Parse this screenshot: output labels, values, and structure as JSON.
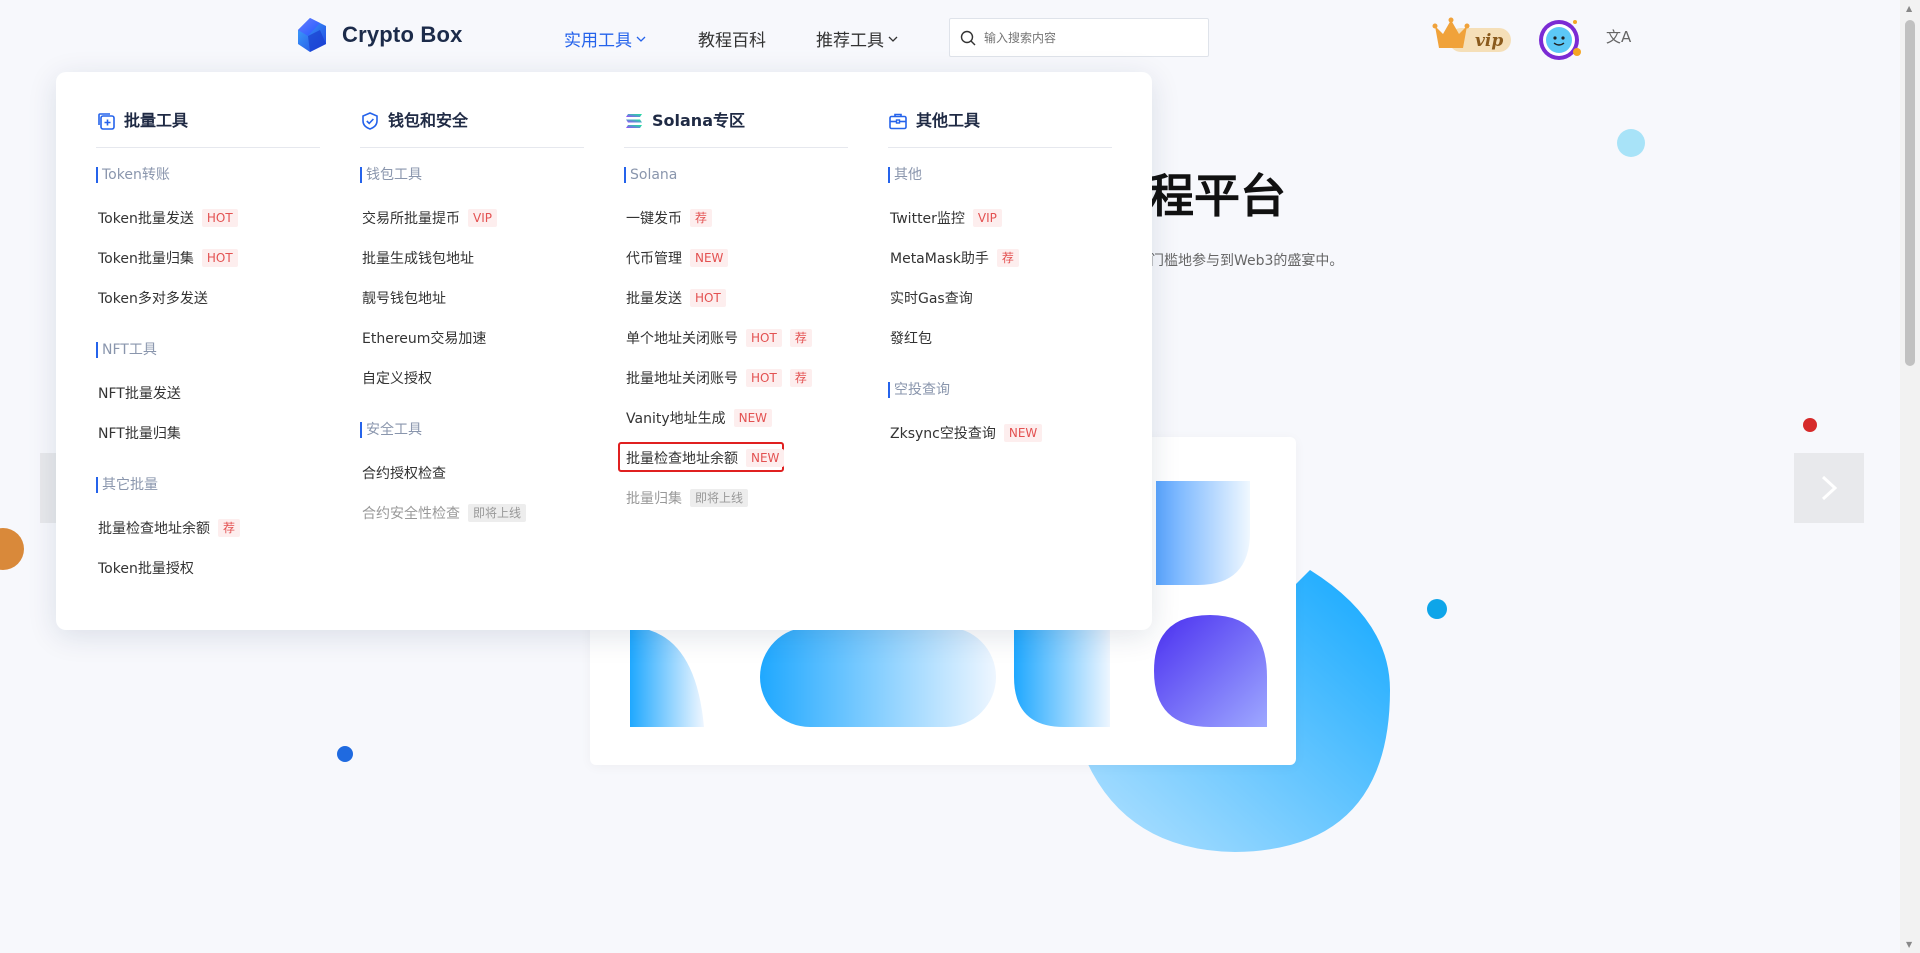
{
  "header": {
    "logo_text": "Crypto Box",
    "nav": [
      {
        "label": "实用工具",
        "active": true,
        "has_chevron": true
      },
      {
        "label": "教程百科",
        "active": false,
        "has_chevron": false
      },
      {
        "label": "推荐工具",
        "active": false,
        "has_chevron": true
      }
    ],
    "search_placeholder": "输入搜索内容",
    "vip_label": "vip",
    "lang_icon": "文A"
  },
  "hero": {
    "title_partial": "程平台",
    "subtitle_partial": "门槛地参与到Web3的盛宴中。"
  },
  "menu": {
    "columns": [
      {
        "title": "批量工具",
        "icon": "copy-icon",
        "sections": [
          {
            "label": "Token转账",
            "items": [
              {
                "label": "Token批量发送",
                "tags": [
                  {
                    "text": "HOT",
                    "style": "red"
                  }
                ]
              },
              {
                "label": "Token批量归集",
                "tags": [
                  {
                    "text": "HOT",
                    "style": "red"
                  }
                ]
              },
              {
                "label": "Token多对多发送",
                "tags": []
              }
            ]
          },
          {
            "label": "NFT工具",
            "items": [
              {
                "label": "NFT批量发送",
                "tags": []
              },
              {
                "label": "NFT批量归集",
                "tags": []
              }
            ]
          },
          {
            "label": "其它批量",
            "items": [
              {
                "label": "批量检查地址余额",
                "tags": [
                  {
                    "text": "荐",
                    "style": "red"
                  }
                ]
              },
              {
                "label": "Token批量授权",
                "tags": []
              }
            ]
          }
        ]
      },
      {
        "title": "钱包和安全",
        "icon": "shield-check-icon",
        "sections": [
          {
            "label": "钱包工具",
            "items": [
              {
                "label": "交易所批量提币",
                "tags": [
                  {
                    "text": "VIP",
                    "style": "red"
                  }
                ]
              },
              {
                "label": "批量生成钱包地址",
                "tags": []
              },
              {
                "label": "靓号钱包地址",
                "tags": []
              },
              {
                "label": "Ethereum交易加速",
                "tags": []
              },
              {
                "label": "自定义授权",
                "tags": []
              }
            ]
          },
          {
            "label": "安全工具",
            "items": [
              {
                "label": "合约授权检查",
                "tags": []
              },
              {
                "label": "合约安全性检查",
                "tags": [
                  {
                    "text": "即将上线",
                    "style": "gray"
                  }
                ],
                "disabled": true
              }
            ]
          }
        ]
      },
      {
        "title": "Solana专区",
        "icon": "solana-icon",
        "sections": [
          {
            "label": "Solana",
            "items": [
              {
                "label": "一键发币",
                "tags": [
                  {
                    "text": "荐",
                    "style": "red"
                  }
                ]
              },
              {
                "label": "代币管理",
                "tags": [
                  {
                    "text": "NEW",
                    "style": "red"
                  }
                ]
              },
              {
                "label": "批量发送",
                "tags": [
                  {
                    "text": "HOT",
                    "style": "red"
                  }
                ]
              },
              {
                "label": "单个地址关闭账号",
                "tags": [
                  {
                    "text": "HOT",
                    "style": "red"
                  },
                  {
                    "text": "荐",
                    "style": "red"
                  }
                ]
              },
              {
                "label": "批量地址关闭账号",
                "tags": [
                  {
                    "text": "HOT",
                    "style": "red"
                  },
                  {
                    "text": "荐",
                    "style": "red"
                  }
                ]
              },
              {
                "label": "Vanity地址生成",
                "tags": [
                  {
                    "text": "NEW",
                    "style": "red"
                  }
                ]
              },
              {
                "label": "批量检查地址余额",
                "tags": [
                  {
                    "text": "NEW",
                    "style": "red"
                  }
                ],
                "highlighted": true
              },
              {
                "label": "批量归集",
                "tags": [
                  {
                    "text": "即将上线",
                    "style": "gray"
                  }
                ],
                "disabled": true
              }
            ]
          }
        ]
      },
      {
        "title": "其他工具",
        "icon": "toolbox-icon",
        "sections": [
          {
            "label": "其他",
            "items": [
              {
                "label": "Twitter监控",
                "tags": [
                  {
                    "text": "VIP",
                    "style": "red"
                  }
                ]
              },
              {
                "label": "MetaMask助手",
                "tags": [
                  {
                    "text": "荐",
                    "style": "red"
                  }
                ]
              },
              {
                "label": "实时Gas查询",
                "tags": []
              },
              {
                "label": "發红包",
                "tags": []
              }
            ]
          },
          {
            "label": "空投查询",
            "items": [
              {
                "label": "Zksync空投查询",
                "tags": [
                  {
                    "text": "NEW",
                    "style": "red"
                  }
                ]
              }
            ]
          }
        ]
      }
    ]
  },
  "colors": {
    "accent": "#2563eb",
    "tag_red": "#e35151",
    "tag_bg": "#fdeeee",
    "highlight_border": "#e02020"
  }
}
